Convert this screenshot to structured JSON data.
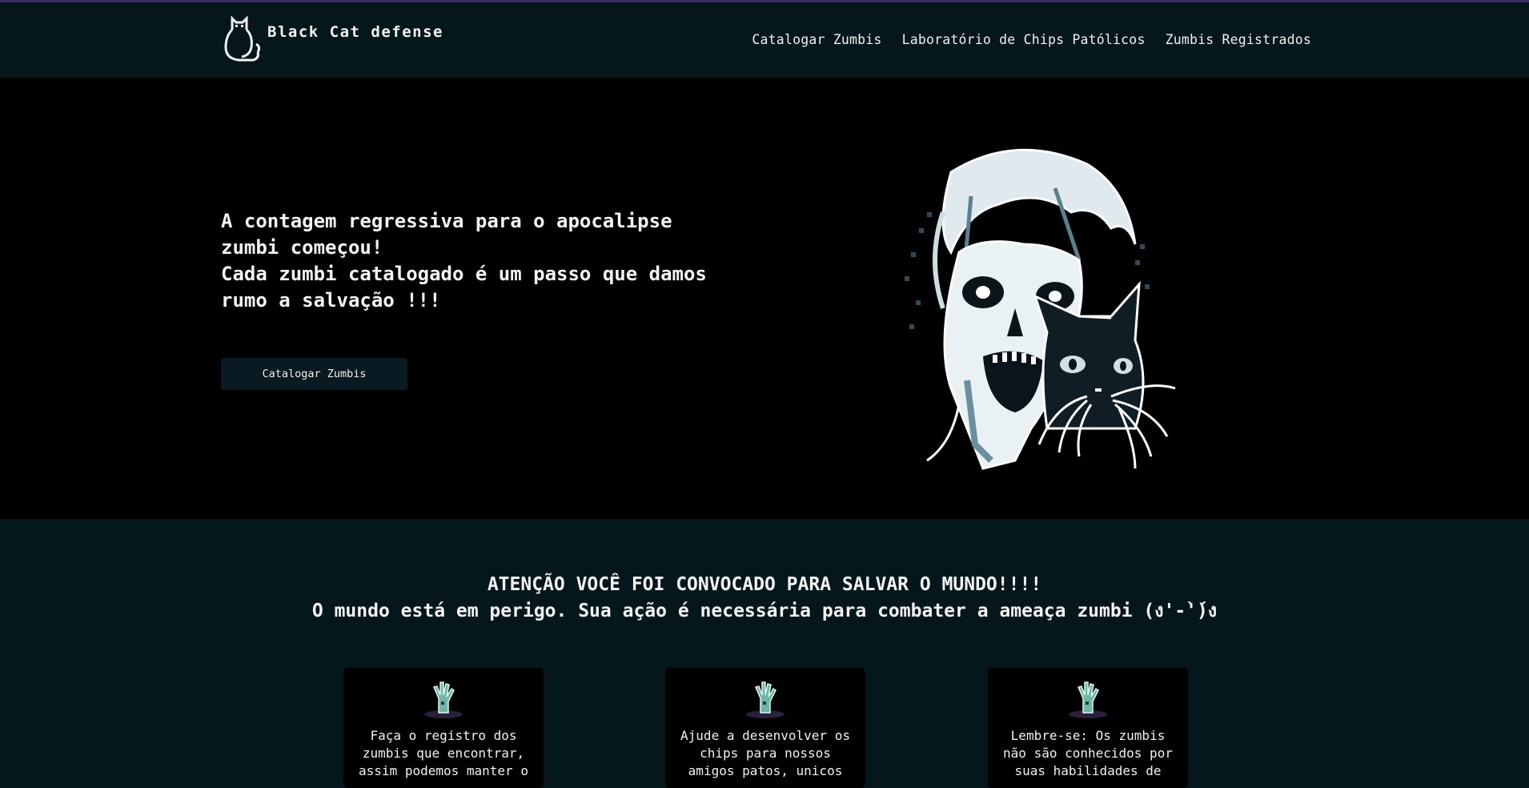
{
  "header": {
    "brand_name": "Black Cat defense",
    "logo_icon": "cat-icon",
    "nav": [
      {
        "label": "Catalogar Zumbis"
      },
      {
        "label": "Laboratório de Chips Patólicos"
      },
      {
        "label": "Zumbis Registrados"
      }
    ]
  },
  "hero": {
    "line1": "A contagem regressiva para o apocalipse zumbi começou!",
    "line2": "Cada zumbi catalogado é um passo que damos rumo a salvação !!!",
    "button_label": "Catalogar Zumbis",
    "image_icon": "zombie-and-cat-illustration"
  },
  "mission": {
    "title": "ATENÇÃO VOCÊ FOI CONVOCADO PARA SALVAR O MUNDO!!!!",
    "subtitle": "O mundo está em perigo. Sua ação é necessária para combater a ameaça zumbi (ง'-̀'́)ง",
    "cards": [
      {
        "icon": "zombie-hand-icon",
        "text": "Faça o registro dos zumbis que encontrar, assim podemos manter o"
      },
      {
        "icon": "zombie-hand-icon",
        "text": "Ajude a desenvolver os chips para nossos amigos patos, unicos"
      },
      {
        "icon": "zombie-hand-icon",
        "text": "Lembre-se: Os zumbis não são conhecidos por suas habilidades de"
      }
    ]
  },
  "colors": {
    "header_bg": "#06171b",
    "hero_bg": "#000000",
    "accent_bar": "#3b2b6a",
    "button_bg": "#0a1a22",
    "text": "#ffffff"
  }
}
